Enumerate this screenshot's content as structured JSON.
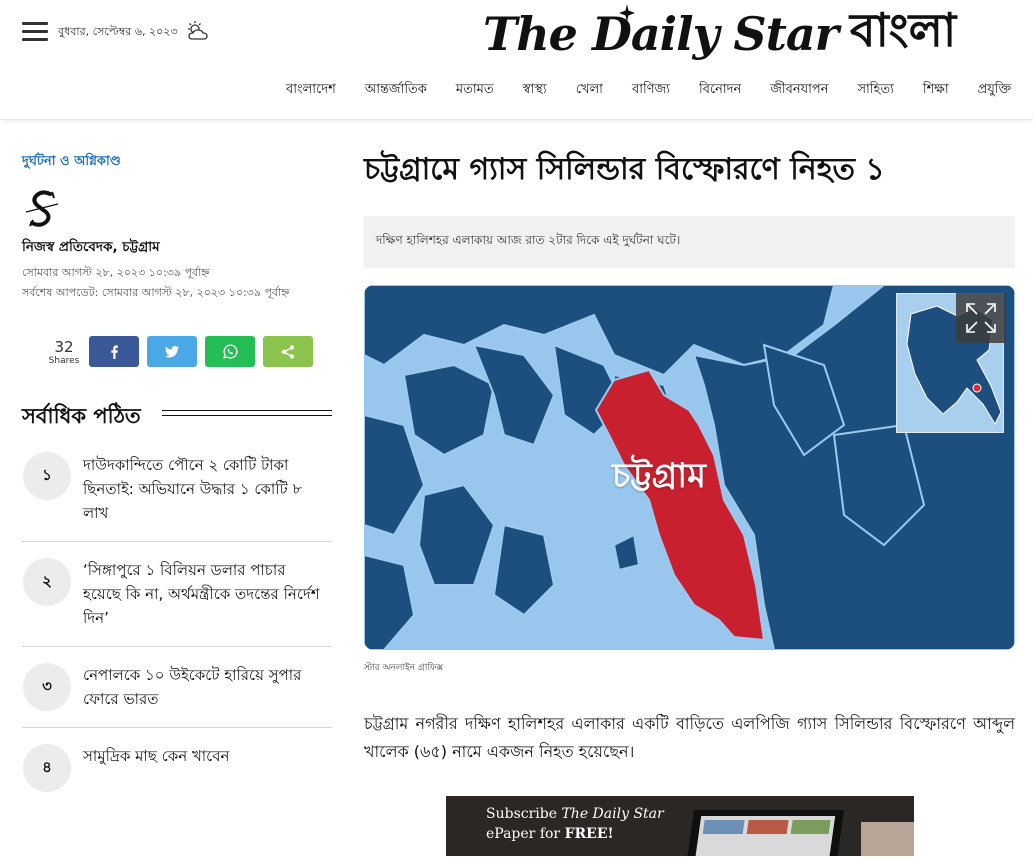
{
  "header": {
    "date": "বুধবার, সেপ্টেম্বর ৬, ২০২৩",
    "logo_en": "The Daily Star",
    "logo_bn": "বাংলা",
    "nav": [
      "বাংলাদেশ",
      "আন্তর্জাতিক",
      "মতামত",
      "স্বাস্থ্য",
      "খেলা",
      "বাণিজ্য",
      "বিনোদন",
      "জীবনযাপন",
      "সাহিত্য",
      "শিক্ষা",
      "প্রযুক্তি"
    ]
  },
  "article": {
    "category": "দুর্ঘটনা ও অগ্নিকাণ্ড",
    "author": "নিজস্ব প্রতিবেদক, চট্টগ্রাম",
    "published": "সোমবার আগস্ট ২৮, ২০২৩ ১০:৩৯ পূর্বাহ্ন",
    "updated": "সর্বশেষ আপডেট: সোমবার আগস্ট ২৮, ২০২৩ ১০:৩৯ পূর্বাহ্ন",
    "headline": "চট্টগ্রামে গ্যাস সিলিন্ডার বিস্ফোরণে নিহত ১",
    "summary": "দক্ষিণ হালিশহর এলাকায় আজ রাত ২টার দিকে এই দুর্ঘটনা ঘটে।",
    "map_label": "চট্টগ্রাম",
    "caption": "স্টার অনলাইন গ্রাফিক্স",
    "body": "চট্টগ্রাম নগরীর দক্ষিণ হালিশহর এলাকার একটি বাড়িতে এলপিজি গ্যাস সিলিন্ডার বিস্ফোরণে আব্দুল খালেক (৬৫) নামে একজন নিহত হয়েছেন।"
  },
  "share": {
    "count": "32",
    "label": "Shares"
  },
  "most_read": {
    "title": "সর্বাধিক পঠিত",
    "items": [
      {
        "num": "১",
        "text": "দাউদকান্দিতে পৌনে ২ কোটি টাকা ছিনতাই: অভিযানে উদ্ধার ১ কোটি ৮ লাখ"
      },
      {
        "num": "২",
        "text": "‘সিঙ্গাপুরে ১ বিলিয়ন ডলার পাচার হয়েছে কি না, অর্থমন্ত্রীকে তদন্তের নির্দেশ দিন’"
      },
      {
        "num": "৩",
        "text": "নেপালকে ১০ উইকেটে হারিয়ে সুপার ফোরে ভারত"
      },
      {
        "num": "৪",
        "text": "সামুদ্রিক মাছ কেন খাবেন"
      }
    ]
  },
  "ad": {
    "line1_prefix": "Subscribe",
    "line1_brand": "The Daily Star",
    "line2_prefix": "ePaper for",
    "line2_emph": "FREE!"
  },
  "colors": {
    "link_blue": "#1f6fb5",
    "facebook": "#3b5998",
    "twitter": "#4aa8e6",
    "whatsapp": "#25bd55",
    "share": "#8ac44d",
    "map_land": "#1d4f7e",
    "map_water": "#98c6ec",
    "map_highlight": "#c8202f"
  },
  "icons": [
    "hamburger-icon",
    "weather-icon",
    "facebook-icon",
    "twitter-icon",
    "whatsapp-icon",
    "share-icon",
    "fullscreen-icon"
  ]
}
